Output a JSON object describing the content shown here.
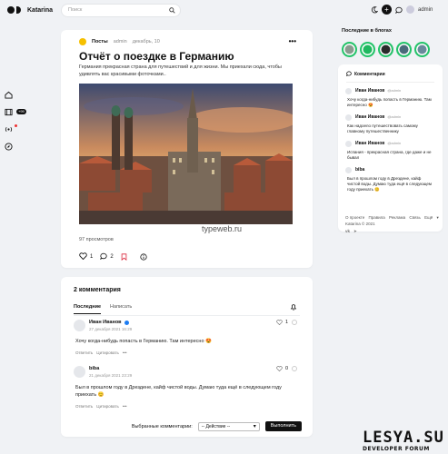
{
  "header": {
    "site_name": "Katarina",
    "search_placeholder": "Поиск",
    "username": "admin"
  },
  "rail": {
    "badge": "+99"
  },
  "post": {
    "category": "Посты",
    "author": "admin",
    "date": "декабрь, 10",
    "title": "Отчёт о поездке в Германию",
    "excerpt": "Германия прекрасная страна для путешествий и для жизни. Мы приехали сюда, чтобы удивлять вас красивыми фоточками..",
    "image_caption": "typeweb.ru",
    "views": "97 просмотров",
    "likes": "1",
    "comments_count": "2"
  },
  "comments": {
    "title": "2 комментария",
    "tabs": [
      "Последние",
      "Написать"
    ],
    "items": [
      {
        "name": "Иван Иванов",
        "date": "27 декабря 2021 16:29",
        "text": "Хочу когда-нибудь попасть в Германию. Там интересно 😍",
        "likes": "1",
        "reply": "Ответить",
        "quote": "Цитировать"
      },
      {
        "name": "biba",
        "date": "21 декабря 2021 23:29",
        "text": "Был в прошлом году в Дрездене, кайф чистой воды. Думаю туда ещё в следующем году приехать 😊",
        "likes": "0",
        "reply": "Ответить",
        "quote": "Цитировать"
      }
    ],
    "selected_label": "Выбранные комментарии:",
    "action_value": "-- Действие --",
    "execute_label": "Выполнить"
  },
  "sidebar": {
    "stories_title": "Последние в блогах",
    "comments_title": "Комментарии",
    "recent": [
      {
        "name": "Иван Иванов",
        "handle": "@admin",
        "text": "Хочу когда-нибудь попасть в Германию. Там интересно 😍"
      },
      {
        "name": "Иван Иванов",
        "handle": "@admin",
        "text": "Как надоело путешествовать самому главному путешественнику"
      },
      {
        "name": "Иван Иванов",
        "handle": "@admin",
        "text": "Испания - прекрасная страна, где даже и не бывал"
      },
      {
        "name": "biba",
        "handle": "",
        "text": "Был в прошлом году в Дрездене, кайф чистой воды. Думаю туда ещё в следующем году приехать 😊"
      }
    ],
    "footer_links": [
      "О проекте",
      "Правила",
      "Реклама",
      "Связь",
      "Ещё"
    ],
    "copyright": "Katarina © 2021"
  },
  "watermark": {
    "line1": "LESYA.SU",
    "line2": "DEVELOPER FORUM"
  },
  "colors": {
    "background": "#f0f2f5",
    "accent": "#111111",
    "category_dot": "#f6c000",
    "story_ring": "#24c46a",
    "notify_dot": "#e33333",
    "verified": "#1d7cf2"
  }
}
